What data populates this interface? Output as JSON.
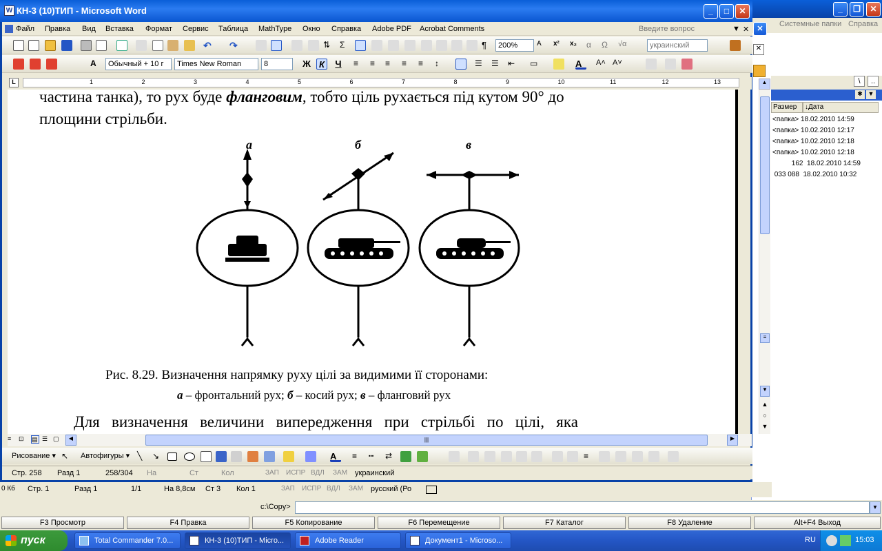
{
  "word": {
    "title": "КН-3 (10)ТИП - Microsoft Word",
    "menu": [
      "Файл",
      "Правка",
      "Вид",
      "Вставка",
      "Формат",
      "Сервис",
      "Таблица",
      "MathType",
      "Окно",
      "Справка",
      "Adobe PDF",
      "Acrobat Comments"
    ],
    "ask_placeholder": "Введите вопрос",
    "zoom": "200%",
    "language_combo": "украинский",
    "style_combo": "Обычный + 10 г",
    "font_combo": "Times New Roman",
    "size_combo": "8",
    "bold_label": "Ж",
    "italic_label": "К",
    "underline_label": "Ч",
    "ruler_numbers": [
      "1",
      "2",
      "3",
      "4",
      "5",
      "6",
      "7",
      "8",
      "9",
      "10",
      "11",
      "12",
      "13"
    ]
  },
  "document": {
    "line1_a": "частина танка), то рух буде ",
    "line1_b": "фланговим",
    "line1_c": ", тобто ціль рухається під кутом 90° до",
    "line2": "площини стрільби.",
    "fig_label_a": "а",
    "fig_label_b": "б",
    "fig_label_c": "в",
    "caption1": "Рис. 8.29. Визначення напрямку руху цілі за видимими її сторонами:",
    "caption2_a": "а",
    "caption2_b": " – фронтальний рух; ",
    "caption2_c": "б",
    "caption2_d": " – косий рух; ",
    "caption2_e": "в",
    "caption2_f": " – фланговий рух",
    "para": "Для   визначення   величини   випередження   при   стрільбі   по   цілі,   яка"
  },
  "drawbar": {
    "drawing": "Рисование",
    "autoshapes": "Автофигуры"
  },
  "status": {
    "page": "Стр.  258",
    "section": "Разд  1",
    "pages": "258/304",
    "at": "На",
    "line": "Ст",
    "col": "Кол",
    "rec": "ЗАП",
    "trk": "ИСПР",
    "ext": "ВДЛ",
    "ovr": "ЗАМ",
    "lang": "украинский"
  },
  "status2": {
    "page": "Стр.  1",
    "section": "Разд  1",
    "pages": "1/1",
    "at": "На  8,8см",
    "line": "Ст  3",
    "col": "Кол  1",
    "rec": "ЗАП",
    "trk": "ИСПР",
    "ext": "ВДЛ",
    "ovr": "ЗАМ",
    "lang": "русский (Ро"
  },
  "tc": {
    "menu_sys": "Системные папки",
    "menu_help": "Справка",
    "col_size": "Размер",
    "col_date": "↓Дата",
    "rows": [
      "<папка> 18.02.2010 14:59",
      "<папка> 10.02.2010 12:17",
      "<папка> 10.02.2010 12:18",
      "<папка> 10.02.2010 12:18",
      "          162  18.02.2010 14:59",
      " 033 088  18.02.2010 10:32"
    ],
    "free": "0 Кб",
    "cmd_path": "c:\\Copy>",
    "fkeys": [
      "F3 Просмотр",
      "F4 Правка",
      "F5 Копирование",
      "F6 Перемещение",
      "F7 Каталог",
      "F8 Удаление",
      "Alt+F4 Выход"
    ]
  },
  "taskbar": {
    "start": "пуск",
    "tasks": [
      "Total Commander 7.0...",
      "КН-3 (10)ТИП - Micro...",
      "Adobe Reader",
      "Документ1 - Microso..."
    ],
    "lang": "RU",
    "clock": "15:03"
  }
}
